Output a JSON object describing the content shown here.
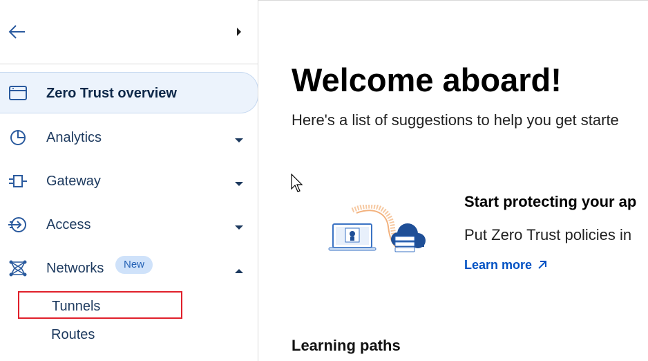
{
  "sidebar": {
    "items": [
      {
        "label": "Zero Trust overview",
        "icon": "browser-window-icon",
        "active": true
      },
      {
        "label": "Analytics",
        "icon": "pie-chart-icon"
      },
      {
        "label": "Gateway",
        "icon": "gateway-icon"
      },
      {
        "label": "Access",
        "icon": "access-icon"
      },
      {
        "label": "Networks",
        "icon": "network-nodes-icon",
        "badge": "New",
        "expanded": true
      }
    ],
    "subitems": [
      {
        "label": "Tunnels",
        "selected": true
      },
      {
        "label": "Routes"
      }
    ]
  },
  "main": {
    "title": "Welcome aboard!",
    "subtitle": "Here's a list of suggestions to help you get starte",
    "card": {
      "title": "Start protecting your ap",
      "description": "Put Zero Trust policies in",
      "link": "Learn more"
    },
    "section_title": "Learning paths"
  },
  "colors": {
    "accent": "#0051c3",
    "active_bg": "#ecf3fc",
    "badge_bg": "#cfe2fa",
    "selection_border": "#e01f2a",
    "nav_text": "#1d3a5f"
  }
}
